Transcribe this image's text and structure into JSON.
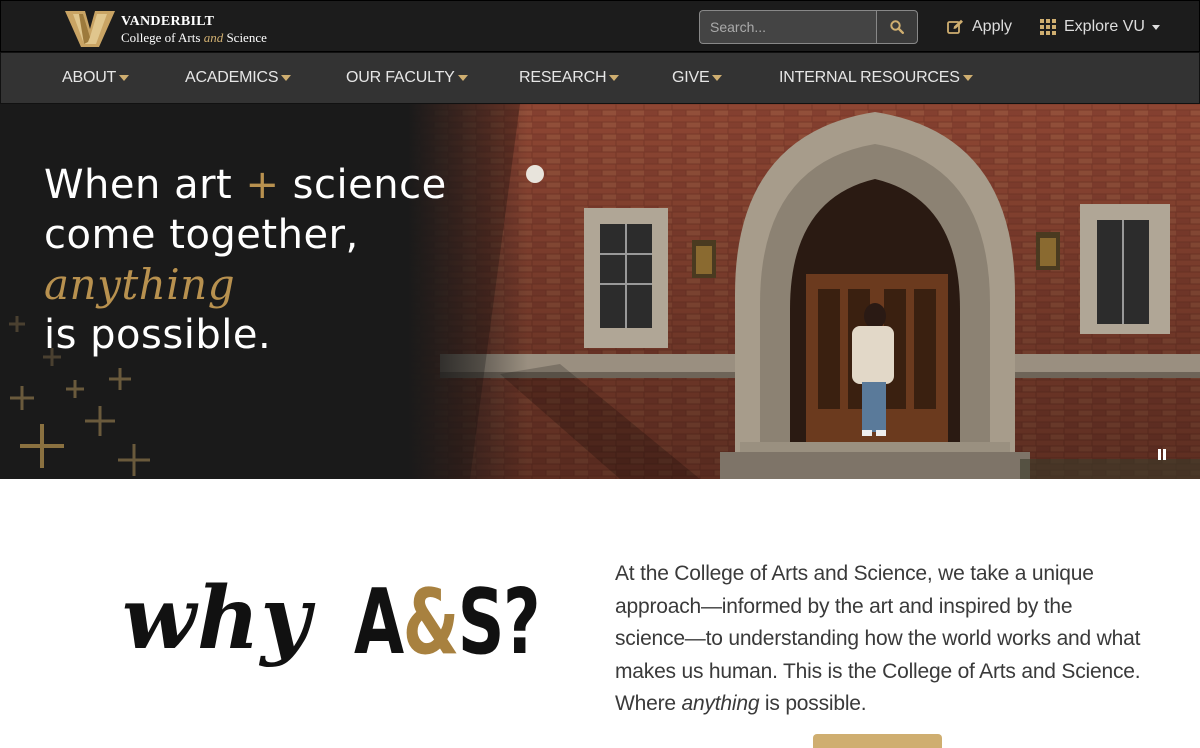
{
  "brand": {
    "name": "VANDERBILT",
    "sub_prefix": "College of Arts",
    "sub_and": "and",
    "sub_suffix": "Science",
    "gold": "#cfae70",
    "dark": "#1c1c1c"
  },
  "header": {
    "search": {
      "placeholder": "Search...",
      "icon": "search-icon"
    },
    "apply": {
      "label": "Apply",
      "icon": "edit-icon"
    },
    "explore": {
      "label": "Explore VU",
      "icon": "grid-icon"
    }
  },
  "nav": {
    "items": [
      {
        "label": "ABOUT"
      },
      {
        "label": "ACADEMICS"
      },
      {
        "label": "OUR FACULTY"
      },
      {
        "label": "RESEARCH"
      },
      {
        "label": "GIVE"
      },
      {
        "label": "INTERNAL RESOURCES"
      }
    ]
  },
  "hero": {
    "line1_a": "When art",
    "line1_plus": "+",
    "line1_b": "science",
    "line2": "come together,",
    "line3": "anything",
    "line4": "is possible."
  },
  "why": {
    "word": "why",
    "a": "A",
    "amp": "&",
    "s": "S?"
  },
  "intro": {
    "text_before": "At the College of Arts and Science, we take a unique approach—informed by the art and inspired by the science—to understanding how the world works and what makes us human. This is the College of Arts and Science. Where ",
    "emphasis": "anything",
    "text_after": " is possible."
  }
}
